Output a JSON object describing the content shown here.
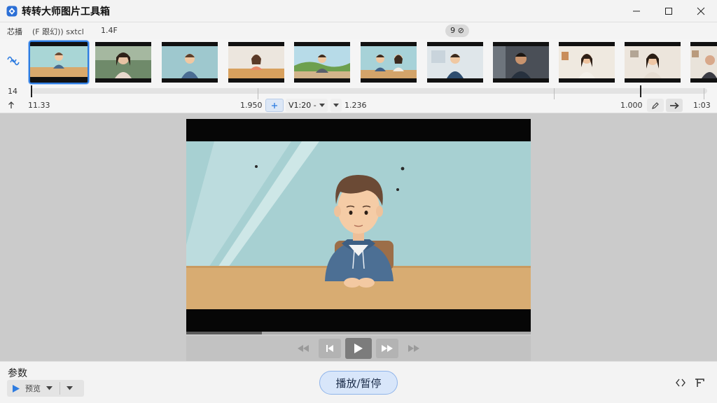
{
  "window": {
    "title": "转转大师图片工具箱",
    "controls": [
      "minimize-icon",
      "maximize-icon",
      "close-icon"
    ]
  },
  "infobar": {
    "item1": "芯播",
    "item2": "(F 跟幻)) sxtcl",
    "item3": "1.4F",
    "zoom": "9 ⊘"
  },
  "filmstrip": {
    "tool_icon": "audio-wave-icon",
    "thumbnails": [
      {
        "scene": "cartoon-man-at-desk",
        "selected": true
      },
      {
        "scene": "woman-green-office"
      },
      {
        "scene": "cartoon-man-teal"
      },
      {
        "scene": "cartoon-woman-desk"
      },
      {
        "scene": "cartoon-man-outdoor"
      },
      {
        "scene": "cartoon-two-people"
      },
      {
        "scene": "cartoon-man-light-room"
      },
      {
        "scene": "man-dark-office"
      },
      {
        "scene": "woman-home"
      },
      {
        "scene": "woman-smiling"
      },
      {
        "scene": "person-partial"
      }
    ]
  },
  "timeline": {
    "row1_label": "14",
    "start_time": "11.33",
    "mid_value": "1.950",
    "track_select": "V1:20 -",
    "track_value": "1.236",
    "end_value": "1.000",
    "end_time": "1:03",
    "progress": 0.9
  },
  "preview": {
    "playback_progress": 0.22
  },
  "bottom": {
    "param_title": "参数",
    "param_select": "预览",
    "play_pause_label": "播放/暂停"
  },
  "colors": {
    "accent": "#2e7ce0",
    "button_bg": "#d8e6fa",
    "button_border": "#8fb4ea"
  }
}
